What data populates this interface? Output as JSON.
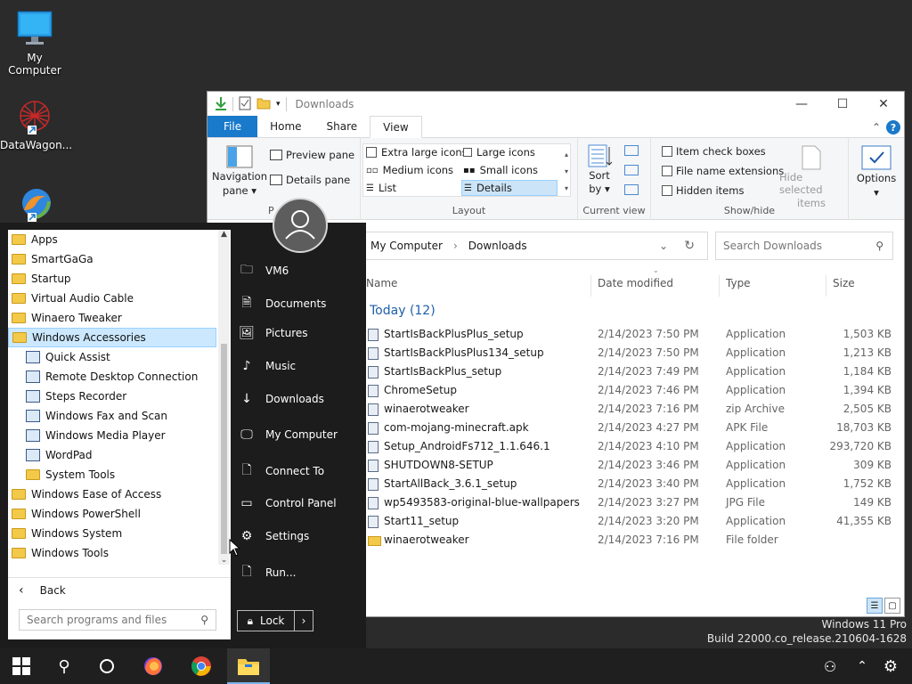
{
  "desktop": {
    "icons": [
      {
        "label": "My Computer"
      },
      {
        "label": "DataWagon..."
      },
      {
        "label": ""
      }
    ]
  },
  "explorer": {
    "title": "Downloads",
    "tabs": [
      "File",
      "Home",
      "Share",
      "View"
    ],
    "active_tab": "View",
    "ribbon": {
      "panes": {
        "navigation_pane": "Navigation",
        "navigation_pane2": "pane",
        "preview_pane": "Preview pane",
        "details_pane": "Details pane",
        "label": "P"
      },
      "layout": {
        "items": [
          "Extra large icons",
          "Large icons",
          "Medium icons",
          "Small icons",
          "List",
          "Details"
        ],
        "selected": "Details",
        "label": "Layout"
      },
      "current_view": {
        "sort_by": "Sort",
        "sort_by2": "by",
        "label": "Current view"
      },
      "show_hide": {
        "item_check_boxes": "Item check boxes",
        "file_name_extensions": "File name extensions",
        "hidden_items": "Hidden items",
        "hide_selected": "Hide selected",
        "hide_selected2": "items",
        "label": "Show/hide"
      },
      "options": "Options"
    },
    "address": [
      "My Computer",
      "Downloads"
    ],
    "search_placeholder": "Search Downloads",
    "columns": {
      "name": "Name",
      "date": "Date modified",
      "type": "Type",
      "size": "Size"
    },
    "group": "Today (12)",
    "files": [
      {
        "name": "StartIsBackPlusPlus_setup",
        "date": "2/14/2023 7:50 PM",
        "type": "Application",
        "size": "1,503 KB",
        "icon": "app-icon"
      },
      {
        "name": "StartIsBackPlusPlus134_setup",
        "date": "2/14/2023 7:50 PM",
        "type": "Application",
        "size": "1,213 KB",
        "icon": "app-icon"
      },
      {
        "name": "StartIsBackPlus_setup",
        "date": "2/14/2023 7:49 PM",
        "type": "Application",
        "size": "1,184 KB",
        "icon": "app-icon"
      },
      {
        "name": "ChromeSetup",
        "date": "2/14/2023 7:46 PM",
        "type": "Application",
        "size": "1,394 KB",
        "icon": "app-icon"
      },
      {
        "name": "winaerotweaker",
        "date": "2/14/2023 7:16 PM",
        "type": "zip Archive",
        "size": "2,505 KB",
        "icon": "zip-icon"
      },
      {
        "name": "com-mojang-minecraft.apk",
        "date": "2/14/2023 4:27 PM",
        "type": "APK File",
        "size": "18,703 KB",
        "icon": "file-icon"
      },
      {
        "name": "Setup_AndroidFs712_1.1.646.1",
        "date": "2/14/2023 4:10 PM",
        "type": "Application",
        "size": "293,720 KB",
        "icon": "app-icon"
      },
      {
        "name": "SHUTDOWN8-SETUP",
        "date": "2/14/2023 3:46 PM",
        "type": "Application",
        "size": "309 KB",
        "icon": "app-icon"
      },
      {
        "name": "StartAllBack_3.6.1_setup",
        "date": "2/14/2023 3:40 PM",
        "type": "Application",
        "size": "1,752 KB",
        "icon": "app-icon"
      },
      {
        "name": "wp5493583-original-blue-wallpapers",
        "date": "2/14/2023 3:27 PM",
        "type": "JPG File",
        "size": "149 KB",
        "icon": "image-icon"
      },
      {
        "name": "Start11_setup",
        "date": "2/14/2023 3:20 PM",
        "type": "Application",
        "size": "41,355 KB",
        "icon": "app-icon"
      },
      {
        "name": "winaerotweaker",
        "date": "2/14/2023 7:16 PM",
        "type": "File folder",
        "size": "",
        "icon": "folder-icon"
      }
    ]
  },
  "start_menu": {
    "programs": [
      {
        "label": "Apps",
        "kind": "folder",
        "sub": false
      },
      {
        "label": "SmartGaGa",
        "kind": "folder",
        "sub": false
      },
      {
        "label": "Startup",
        "kind": "folder",
        "sub": false
      },
      {
        "label": "Virtual Audio Cable",
        "kind": "folder",
        "sub": false
      },
      {
        "label": "Winaero Tweaker",
        "kind": "folder",
        "sub": false
      },
      {
        "label": "Windows Accessories",
        "kind": "folder",
        "sub": false,
        "selected": true
      },
      {
        "label": "Quick Assist",
        "kind": "app",
        "sub": true
      },
      {
        "label": "Remote Desktop Connection",
        "kind": "app",
        "sub": true
      },
      {
        "label": "Steps Recorder",
        "kind": "app",
        "sub": true
      },
      {
        "label": "Windows Fax and Scan",
        "kind": "app",
        "sub": true
      },
      {
        "label": "Windows Media Player",
        "kind": "app",
        "sub": true
      },
      {
        "label": "WordPad",
        "kind": "app",
        "sub": true
      },
      {
        "label": "System Tools",
        "kind": "folder",
        "sub": true
      },
      {
        "label": "Windows Ease of Access",
        "kind": "folder",
        "sub": false
      },
      {
        "label": "Windows PowerShell",
        "kind": "folder",
        "sub": false
      },
      {
        "label": "Windows System",
        "kind": "folder",
        "sub": false
      },
      {
        "label": "Windows Tools",
        "kind": "folder",
        "sub": false
      }
    ],
    "back_label": "Back",
    "search_placeholder": "Search programs and files",
    "places": [
      {
        "label": "VM6",
        "icon": "user-folder-icon"
      },
      {
        "label": "Documents",
        "icon": "document-icon"
      },
      {
        "label": "Pictures",
        "icon": "picture-icon"
      },
      {
        "label": "Music",
        "icon": "music-icon"
      },
      {
        "label": "Downloads",
        "icon": "download-icon"
      },
      {
        "label": "My Computer",
        "icon": "computer-icon"
      },
      {
        "label": "Connect To",
        "icon": "connect-icon"
      },
      {
        "label": "Control Panel",
        "icon": "control-panel-icon"
      },
      {
        "label": "Settings",
        "icon": "gear-icon"
      },
      {
        "label": "Run...",
        "icon": "run-icon"
      }
    ],
    "lock_label": "Lock"
  },
  "watermark": {
    "line1": "Windows 11 Pro",
    "line2": "Build 22000.co_release.210604-1628"
  },
  "colors": {
    "accent": "#1979ca",
    "selection": "#cce8ff",
    "start_bg": "#1c1c1c",
    "taskbar_bg": "#1f1f1f"
  }
}
